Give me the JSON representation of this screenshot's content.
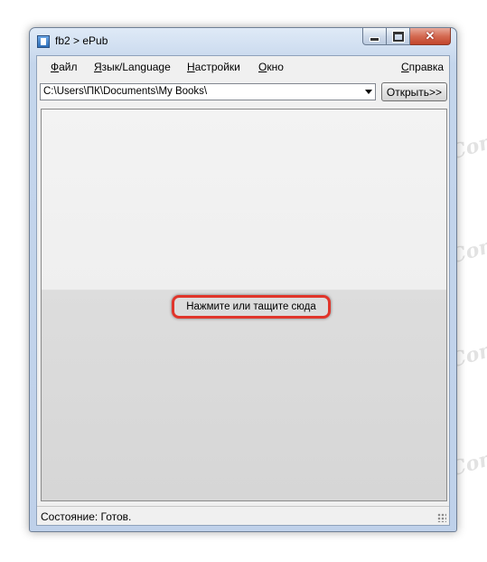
{
  "window": {
    "title": "fb2 > ePub",
    "close_symbol": "✕"
  },
  "menu": [
    {
      "label": "Файл",
      "underline": "Ф",
      "rest": "айл"
    },
    {
      "label": "Язык/Language",
      "underline": "Я",
      "rest": "зык/Language"
    },
    {
      "label": "Настройки",
      "underline": "Н",
      "rest": "астройки"
    },
    {
      "label": "Окно",
      "underline": "О",
      "rest": "кно"
    },
    {
      "label": "Справка",
      "underline": "С",
      "rest": "правка"
    }
  ],
  "path": {
    "value": "C:\\Users\\ПК\\Documents\\My Books\\"
  },
  "open_button": {
    "label": "Открыть>>"
  },
  "drop_area": {
    "label": "Нажмите или тащите сюда"
  },
  "status": {
    "text": "Состояние:  Готов."
  },
  "watermark": {
    "text": "Soringpcrepair.Com"
  },
  "colors": {
    "highlight": "#e0352b",
    "close_button": "#c2452b"
  }
}
